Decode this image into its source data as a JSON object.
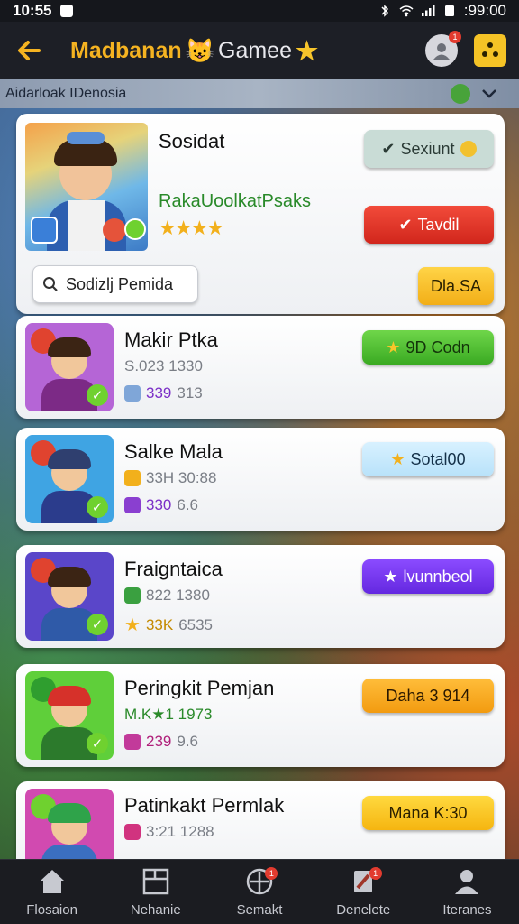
{
  "status_bar": {
    "time": "10:55",
    "right_text": ":99:00"
  },
  "header": {
    "title_part1": "Madbanan",
    "title_part2": "Gamee",
    "colors": {
      "title": "#f5b321",
      "accent": "#f5c326"
    }
  },
  "region_bar": {
    "label": "Aidarloak IDenosia"
  },
  "featured": {
    "name": "Sosidat",
    "subtitle": "RakaUoolkatPsaks",
    "stars": "★★★★",
    "status_label": "Sexiunt",
    "action_label": "Tavdil",
    "search_placeholder": "Sodizlj Pemida",
    "secondary_label": "Dla.SA"
  },
  "rows": [
    {
      "name": "Makir Ptka",
      "line1": "S.023 1330",
      "line2_highlight": "339",
      "line2_rest": "313",
      "button": "9D Codn",
      "button_icon": "star-icon",
      "thumb_bg": "#b565d6",
      "body_color": "#7c2a86"
    },
    {
      "name": "Salke Mala",
      "line1": "33H 30:88",
      "line2_highlight": "330",
      "line2_rest": "6.6",
      "button": "Sotal00",
      "button_icon": "star-icon",
      "thumb_bg": "#3fa4e3",
      "body_color": "#2b3c8c"
    },
    {
      "name": "Fraigntaica",
      "line1": "822 1380",
      "line2_highlight": "33K",
      "line2_rest": "6535",
      "button": "lvunnbeol",
      "button_icon": "star-icon",
      "thumb_bg": "#5a46c9",
      "body_color": "#2f5aa8"
    },
    {
      "name": "Peringkit Pemjan",
      "line1": "M.K★1 1973",
      "line2_highlight": "239",
      "line2_rest": "9.6",
      "button": "Daha 3 914",
      "button_icon": "",
      "thumb_bg": "#5fcf3a",
      "body_color": "#2c7a2c"
    },
    {
      "name": "Patinkakt Permlak",
      "line1": "3:21 1288",
      "line2_highlight": "",
      "line2_rest": "",
      "button": "Mana K:30",
      "button_icon": "",
      "thumb_bg": "#d14ab0",
      "body_color": "#3b6fc0"
    }
  ],
  "bottom_nav": [
    {
      "label": "Flosaion",
      "icon": "home-icon"
    },
    {
      "label": "Nehanie",
      "icon": "board-icon"
    },
    {
      "label": "Semakt",
      "icon": "crosshair-icon"
    },
    {
      "label": "Denelete",
      "icon": "tag-icon"
    },
    {
      "label": "Iteranes",
      "icon": "user-icon"
    }
  ]
}
